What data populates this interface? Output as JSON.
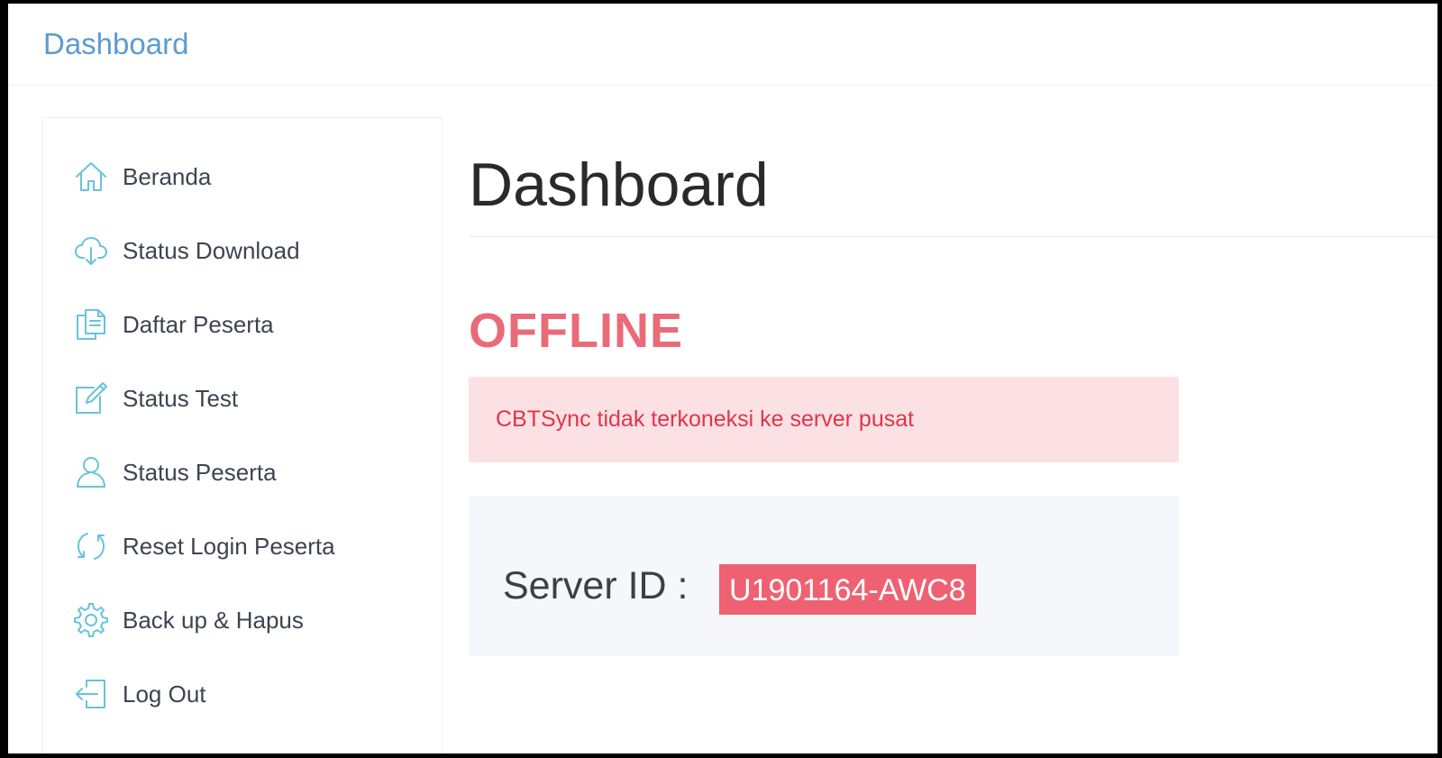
{
  "navbar": {
    "brand": "Dashboard"
  },
  "sidebar": {
    "items": [
      {
        "label": "Beranda",
        "icon": "home-icon"
      },
      {
        "label": "Status Download",
        "icon": "cloud-download-icon"
      },
      {
        "label": "Daftar Peserta",
        "icon": "documents-icon"
      },
      {
        "label": "Status Test",
        "icon": "note-edit-icon"
      },
      {
        "label": "Status Peserta",
        "icon": "user-icon"
      },
      {
        "label": "Reset Login Peserta",
        "icon": "refresh-icon"
      },
      {
        "label": "Back up & Hapus",
        "icon": "gear-icon"
      },
      {
        "label": "Log Out",
        "icon": "logout-icon"
      }
    ],
    "icon_color": "#67c4dc"
  },
  "main": {
    "title": "Dashboard",
    "status": "OFFLINE",
    "alert": "CBTSync tidak terkoneksi ke server pusat",
    "server_label": "Server ID :",
    "server_id": "U1901164-AWC8"
  },
  "colors": {
    "brand": "#5b9bd1",
    "danger": "#ea6a78",
    "alert_bg": "#fbe1e3",
    "alert_text": "#e1344e",
    "badge_bg": "#ee6172",
    "panel_bg": "#f6f7fa"
  }
}
